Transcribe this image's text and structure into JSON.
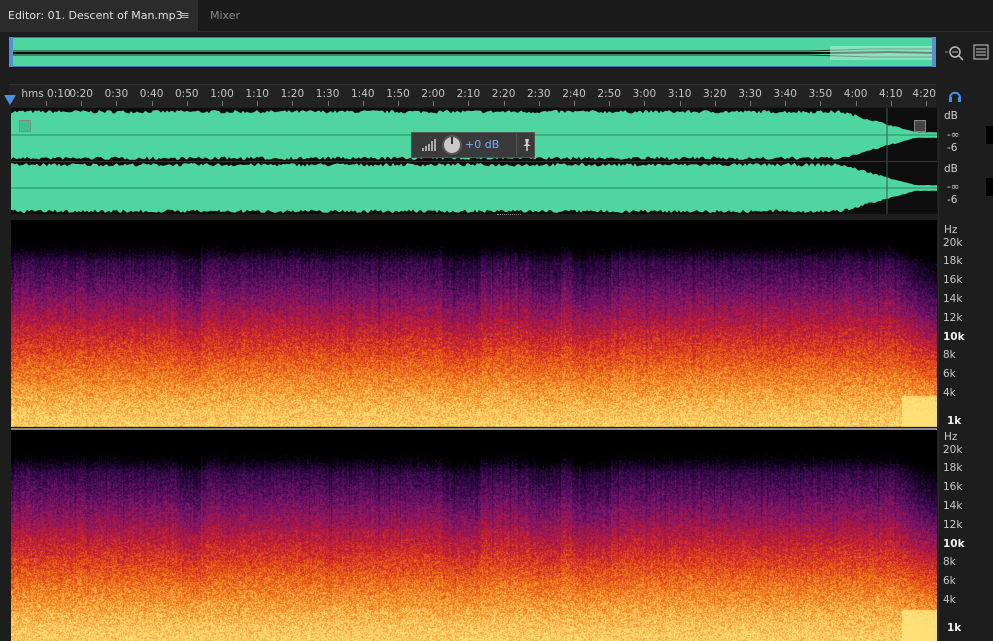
{
  "tabs": {
    "editor_label": "Editor: 01. Descent of Man.mp3",
    "menu_glyph": "≡",
    "mixer_label": "Mixer"
  },
  "icons": {
    "zoom": "zoom-icon",
    "list": "list-icon",
    "headphones": "headphones-icon",
    "pin": "pin-icon"
  },
  "ruler": {
    "labels": [
      "hms 0:10",
      "0:20",
      "0:30",
      "0:40",
      "0:50",
      "1:00",
      "1:10",
      "1:20",
      "1:30",
      "1:40",
      "1:50",
      "2:00",
      "2:10",
      "2:20",
      "2:30",
      "2:40",
      "2:50",
      "3:00",
      "3:10",
      "3:20",
      "3:30",
      "3:40",
      "3:50",
      "4:00",
      "4:10",
      "4:20"
    ]
  },
  "waveform": {
    "channel1": {
      "unit": "dB",
      "mark1": "-∞",
      "mark2": "-6"
    },
    "channel2": {
      "unit": "dB",
      "mark1": "-∞",
      "mark2": "-6"
    },
    "color": "#4fd6a0"
  },
  "hud": {
    "gain_text": "+0 dB"
  },
  "spectrum": {
    "channel1": {
      "unit": "Hz",
      "labels": [
        "20k",
        "18k",
        "16k",
        "14k",
        "12k",
        "10k",
        "8k",
        "6k",
        "4k",
        "1k"
      ]
    },
    "channel2": {
      "unit": "Hz",
      "labels": [
        "20k",
        "18k",
        "16k",
        "14k",
        "12k",
        "10k",
        "8k",
        "6k",
        "4k",
        "1k"
      ]
    }
  }
}
